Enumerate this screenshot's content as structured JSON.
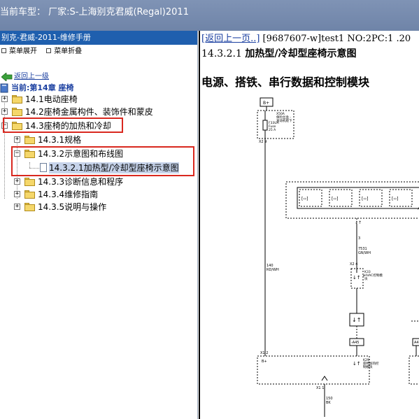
{
  "window": {
    "title": "当前车型：  厂家:S-上海别克君威(Regal)2011"
  },
  "left_pane": {
    "header": "别克-君威-2011-维修手册",
    "actions": {
      "expand": "菜单展开",
      "collapse": "菜单折叠"
    },
    "back_link": "返回上一级",
    "current": "当前:第14章 座椅",
    "tree": [
      {
        "label": "14.1电动座椅",
        "expander": "+"
      },
      {
        "label": "14.2座椅金属构件、装饰件和蒙皮",
        "expander": "+"
      },
      {
        "label": "14.3座椅的加热和冷却",
        "expander": "−"
      },
      {
        "label": "14.3.1规格",
        "expander": "+"
      },
      {
        "label": "14.3.2示意图和布线图",
        "expander": "−"
      },
      {
        "label": "14.3.2.1加热型/冷却型座椅示意图",
        "expander": ""
      },
      {
        "label": "14.3.3诊断信息和程序",
        "expander": "+"
      },
      {
        "label": "14.3.4维修指南",
        "expander": "+"
      },
      {
        "label": "14.3.5说明与操作",
        "expander": "+"
      }
    ]
  },
  "right_pane": {
    "back_link": "[返回上一页..]",
    "doc_meta": " [9687607-w]test1 NO:2PC:1 .20",
    "section_number": "14.3.2.1",
    "section_title": "加热型/冷却型座椅示意图",
    "subheading": "电源、搭铁、串行数据和控制模块",
    "diagram_labels": {
      "bplus": "B+",
      "fuse_desc1": "X50A",
      "fuse_desc2": "保险丝盒 -",
      "fuse_desc3": "发动机舱下",
      "fuse_name1": "F33UA",
      "fuse_name2": "Fuse",
      "fuse_name3": "25 A",
      "x2_9": "X2  9",
      "pin3": "3",
      "wire_7531": "7531",
      "wire_gnwh": "GN/WH",
      "x2_4": "X2  4",
      "k33_1": "K33",
      "k33_2": "HVAC控制模",
      "k33_3": "块",
      "wire_140": "140",
      "wire_rdwh": "RD/WH",
      "a45": "-A45",
      "a4_short": "A4",
      "x1_2": "X1  2",
      "bplus2": "B+",
      "k29_1": "K29",
      "k29_2": "座椅加热控",
      "k29_3": "制模块",
      "x1_1": "X1  1",
      "wire_150": "150",
      "wire_bk": "BK",
      "a_side": "A"
    }
  }
}
